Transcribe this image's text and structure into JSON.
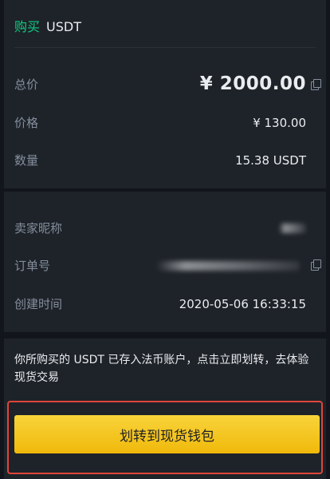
{
  "header": {
    "action": "购买",
    "coin": "USDT"
  },
  "summary": {
    "total_label": "总价",
    "total_value": "¥ 2000.00",
    "price_label": "价格",
    "price_value": "¥ 130.00",
    "quantity_label": "数量",
    "quantity_value": "15.38 USDT"
  },
  "details": {
    "seller_label": "卖家昵称",
    "order_label": "订单号",
    "created_label": "创建时间",
    "created_value": "2020-05-06 16:33:15"
  },
  "notice": {
    "text": "你所购买的 USDT 已存入法币账户，点击立即划转，去体验现货交易"
  },
  "actions": {
    "transfer_label": "划转到现货钱包"
  },
  "colors": {
    "buy_green": "#0ecb81",
    "button_yellow": "#f0b90b",
    "highlight_red": "#e0463a"
  }
}
